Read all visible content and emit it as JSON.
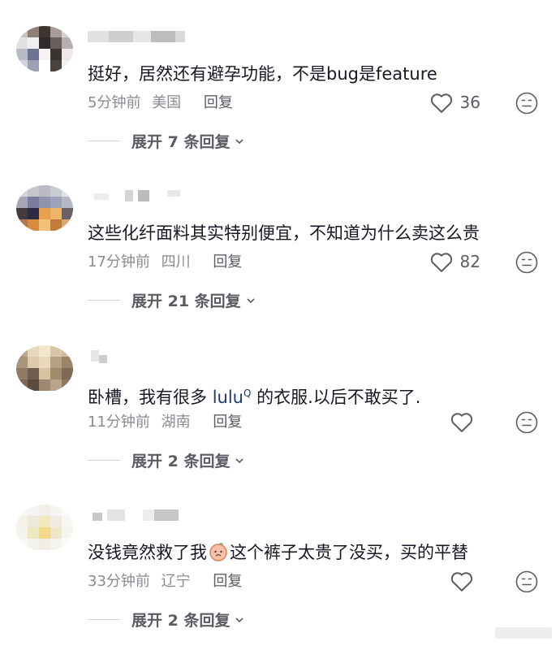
{
  "comments": [
    {
      "text": "挺好，居然还有避孕功能，不是bug是feature",
      "time": "5分钟前",
      "location": "美国",
      "reply_label": "回复",
      "likes": "36",
      "expand": "展开 7 条回复"
    },
    {
      "text": "这些化纤面料其实特别便宜，不知道为什么卖这么贵",
      "time": "17分钟前",
      "location": "四川",
      "reply_label": "回复",
      "likes": "82",
      "expand": "展开 21 条回复"
    },
    {
      "text_before": "卧槽，我有很多 ",
      "link": "lulu",
      "link_sup": "Q",
      "text_after": " 的衣服.以后不敢买了.",
      "time": "11分钟前",
      "location": "湖南",
      "reply_label": "回复",
      "likes": "",
      "expand": "展开 2 条回复"
    },
    {
      "text_before": "没钱竟然救了我",
      "text_after": "这个裤子太贵了没买，买的平替",
      "time": "33分钟前",
      "location": "辽宁",
      "reply_label": "回复",
      "likes": "",
      "expand": "展开 2 条回复"
    }
  ],
  "icons": {
    "like": "heart-outline-icon",
    "dislike": "neutral-face-icon",
    "emoji": "peach-emoji-icon",
    "expand": "chevron-down-icon"
  },
  "colors": {
    "text": "#161823",
    "meta": "#8a8b91",
    "link": "#1c3a78"
  }
}
